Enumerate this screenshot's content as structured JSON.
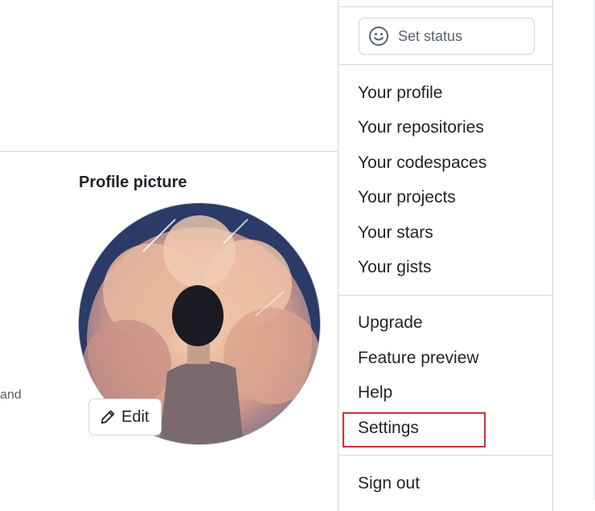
{
  "profile": {
    "section_title": "Profile picture",
    "edit_label": "Edit",
    "truncated_text": "and"
  },
  "menu": {
    "status_label": "Set status",
    "group1": [
      "Your profile",
      "Your repositories",
      "Your codespaces",
      "Your projects",
      "Your stars",
      "Your gists"
    ],
    "group2": [
      "Upgrade",
      "Feature preview",
      "Help",
      "Settings"
    ],
    "sign_out": "Sign out",
    "highlighted_item": "Settings"
  },
  "icons": {
    "status": "smiley-icon",
    "edit": "pencil-icon"
  },
  "colors": {
    "highlight_border": "#d32f3a",
    "border": "#d0d7de",
    "text": "#1f2328",
    "muted": "#59636e"
  }
}
